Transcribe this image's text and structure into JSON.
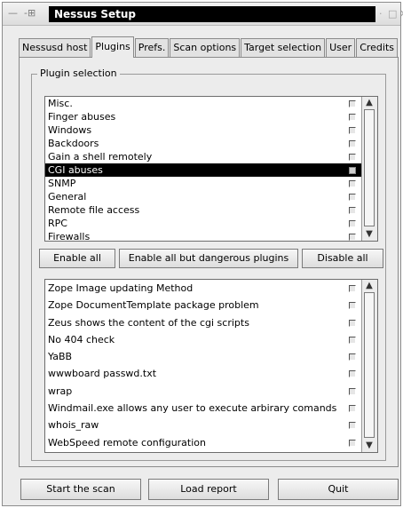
{
  "window": {
    "title": "Nessus Setup",
    "titlebar_left_icons": [
      "—",
      "-⊞"
    ],
    "titlebar_right_icons": [
      "·",
      "□",
      "✕"
    ]
  },
  "tabs": [
    {
      "label": "Nessusd host",
      "active": false
    },
    {
      "label": "Plugins",
      "active": true
    },
    {
      "label": "Prefs.",
      "active": false
    },
    {
      "label": "Scan options",
      "active": false
    },
    {
      "label": "Target selection",
      "active": false
    },
    {
      "label": "User",
      "active": false
    },
    {
      "label": "Credits",
      "active": false
    }
  ],
  "plugin_selection": {
    "group_label": "Plugin selection",
    "families": [
      {
        "label": "Misc.",
        "selected": false
      },
      {
        "label": "Finger abuses",
        "selected": false
      },
      {
        "label": "Windows",
        "selected": false
      },
      {
        "label": "Backdoors",
        "selected": false
      },
      {
        "label": "Gain a shell remotely",
        "selected": false
      },
      {
        "label": "CGI abuses",
        "selected": true
      },
      {
        "label": "SNMP",
        "selected": false
      },
      {
        "label": "General",
        "selected": false
      },
      {
        "label": "Remote file access",
        "selected": false
      },
      {
        "label": "RPC",
        "selected": false
      },
      {
        "label": "Firewalls",
        "selected": false
      }
    ],
    "buttons": {
      "enable_all": "Enable all",
      "enable_all_but_dangerous": "Enable all but dangerous plugins",
      "disable_all": "Disable all"
    },
    "plugins": [
      {
        "label": "Zope Image updating Method"
      },
      {
        "label": "Zope DocumentTemplate package problem"
      },
      {
        "label": "Zeus shows the content of the cgi scripts"
      },
      {
        "label": "No 404 check"
      },
      {
        "label": "YaBB"
      },
      {
        "label": "wwwboard passwd.txt"
      },
      {
        "label": "wrap"
      },
      {
        "label": "Windmail.exe allows any user to execute arbirary comands"
      },
      {
        "label": "whois_raw"
      },
      {
        "label": "WebSpeed remote configuration"
      }
    ]
  },
  "bottom_buttons": {
    "start_scan": "Start the scan",
    "load_report": "Load report",
    "quit": "Quit"
  },
  "colors": {
    "selection_bg": "#000000",
    "selection_fg": "#ffffff",
    "window_bg": "#ececec",
    "title_bg": "#000000"
  }
}
